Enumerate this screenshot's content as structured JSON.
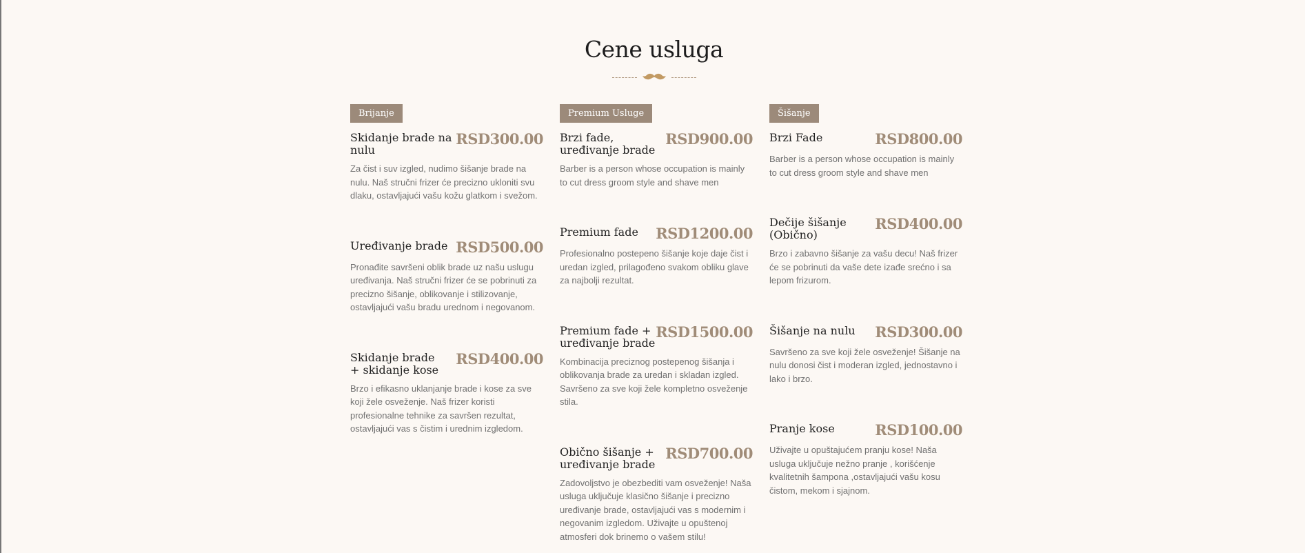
{
  "page": {
    "title": "Cene usluga",
    "accent_color": "#9c8a7a",
    "price_color": "#a08c78",
    "divider_icon": "mustache-icon"
  },
  "columns": [
    {
      "tag": "Brijanje",
      "items": [
        {
          "name": "Skidanje brade na nulu",
          "price": "RSD300.00",
          "desc": "Za čist i suv izgled, nudimo šišanje brade na nulu. Naš stručni frizer će precizno ukloniti svu dlaku, ostavljajući vašu kožu glatkom i svežom."
        },
        {
          "name": "Uređivanje brade",
          "price": "RSD500.00",
          "desc": "Pronađite savršeni oblik brade uz našu uslugu uređivanja. Naš stručni frizer će se pobrinuti za precizno šišanje, oblikovanje i stilizovanje, ostavljajući vašu bradu urednom i negovanom."
        },
        {
          "name": "Skidanje brade + skidanje kose",
          "price": "RSD400.00",
          "desc": "Brzo i efikasno uklanjanje brade i kose za sve koji žele osveženje. Naš frizer koristi profesionalne tehnike za savršen rezultat, ostavljajući vas s čistim i urednim izgledom."
        }
      ]
    },
    {
      "tag": "Premium Usluge",
      "items": [
        {
          "name": "Brzi fade, uređivanje brade",
          "price": "RSD900.00",
          "desc": "Barber is a person whose occupation is mainly to cut dress groom style and shave men"
        },
        {
          "name": "Premium fade",
          "price": "RSD1200.00",
          "desc": "Profesionalno postepeno šišanje koje daje čist i uredan izgled, prilagođeno svakom obliku glave za najbolji rezultat."
        },
        {
          "name": "Premium fade + uređivanje brade",
          "price": "RSD1500.00",
          "desc": "Kombinacija preciznog postepenog šišanja i oblikovanja brade za uredan i skladan izgled. Savršeno za sve koji žele kompletno osveženje stila."
        },
        {
          "name": "Obično šišanje + uređivanje brade",
          "price": "RSD700.00",
          "desc": "Zadovoljstvo je obezbediti vam osveženje! Naša usluga uključuje klasično šišanje i precizno uređivanje brade, ostavljajući vas s modernim i negovanim izgledom. Uživajte u opuštenoj atmosferi dok brinemo o vašem stilu!"
        }
      ]
    },
    {
      "tag": "Šišanje",
      "items": [
        {
          "name": "Brzi Fade",
          "price": "RSD800.00",
          "desc": "Barber is a person whose occupation is mainly to cut dress groom style and shave men"
        },
        {
          "name": "Dečije šišanje (Obično)",
          "price": "RSD400.00",
          "desc": "Brzo i zabavno šišanje za vašu decu! Naš frizer će se pobrinuti da vaše dete izađe srećno i sa lepom frizurom."
        },
        {
          "name": "Šišanje na nulu",
          "price": "RSD300.00",
          "desc": "Savršeno za sve koji žele osveženje! Šišanje na nulu donosi čist i moderan izgled, jednostavno i lako i brzo."
        },
        {
          "name": "Pranje kose",
          "price": "RSD100.00",
          "desc": "Uživajte u opuštajućem pranju kose! Naša usluga uključuje nežno pranje , korišćenje kvalitetnih šampona ,ostavljajući vašu kosu čistom, mekom i sjajnom."
        }
      ]
    }
  ]
}
